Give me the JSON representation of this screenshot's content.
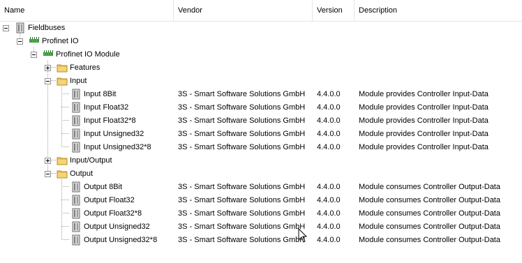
{
  "columns": {
    "name": "Name",
    "vendor": "Vendor",
    "version": "Version",
    "description": "Description"
  },
  "tree": {
    "fieldbuses": "Fieldbuses",
    "profinet_io": "Profinet IO",
    "profinet_module": "Profinet IO Module",
    "features": "Features",
    "input": "Input",
    "input_output": "Input/Output",
    "output": "Output"
  },
  "input_rows": [
    {
      "name": "Input 8Bit",
      "vendor": "3S - Smart Software Solutions GmbH",
      "version": "4.4.0.0",
      "description": "Module provides Controller Input-Data"
    },
    {
      "name": "Input Float32",
      "vendor": "3S - Smart Software Solutions GmbH",
      "version": "4.4.0.0",
      "description": "Module provides Controller Input-Data"
    },
    {
      "name": "Input Float32*8",
      "vendor": "3S - Smart Software Solutions GmbH",
      "version": "4.4.0.0",
      "description": "Module provides Controller Input-Data"
    },
    {
      "name": "Input Unsigned32",
      "vendor": "3S - Smart Software Solutions GmbH",
      "version": "4.4.0.0",
      "description": "Module provides Controller Input-Data"
    },
    {
      "name": "Input Unsigned32*8",
      "vendor": "3S - Smart Software Solutions GmbH",
      "version": "4.4.0.0",
      "description": "Module provides Controller Input-Data"
    }
  ],
  "output_rows": [
    {
      "name": "Output 8Bit",
      "vendor": "3S - Smart Software Solutions GmbH",
      "version": "4.4.0.0",
      "description": "Module consumes Controller Output-Data"
    },
    {
      "name": "Output Float32",
      "vendor": "3S - Smart Software Solutions GmbH",
      "version": "4.4.0.0",
      "description": "Module consumes Controller Output-Data"
    },
    {
      "name": "Output Float32*8",
      "vendor": "3S - Smart Software Solutions GmbH",
      "version": "4.4.0.0",
      "description": "Module consumes Controller Output-Data"
    },
    {
      "name": "Output Unsigned32",
      "vendor": "3S - Smart Software Solutions GmbH",
      "version": "4.4.0.0",
      "description": "Module consumes Controller Output-Data"
    },
    {
      "name": "Output Unsigned32*8",
      "vendor": "3S - Smart Software Solutions GmbH",
      "version": "4.4.0.0",
      "description": "Module consumes Controller Output-Data"
    }
  ],
  "colors": {
    "folder": "#e8c35a",
    "folder_edge": "#b58b22",
    "module": "#8e8e8e",
    "fieldbus_green": "#3c9a3c",
    "tree_line": "#a0a0a0"
  },
  "icons": {
    "collapse": "minus-box-icon",
    "expand": "plus-box-icon",
    "folder": "folder-icon",
    "module": "module-device-icon",
    "fieldbus": "fieldbus-icon",
    "cursor": "mouse-pointer-icon"
  }
}
